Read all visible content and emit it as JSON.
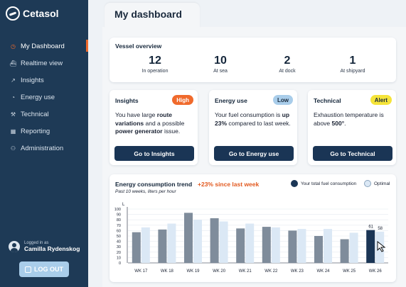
{
  "brand": {
    "name": "Cetasol"
  },
  "nav": [
    {
      "label": "My Dashboard",
      "icon": "dashboard-icon",
      "active": true
    },
    {
      "label": "Realtime view",
      "icon": "ship-icon",
      "active": false
    },
    {
      "label": "Insights",
      "icon": "trend-icon",
      "active": false
    },
    {
      "label": "Energy use",
      "icon": "gauge-icon",
      "active": false
    },
    {
      "label": "Technical",
      "icon": "wrench-icon",
      "active": false
    },
    {
      "label": "Reporting",
      "icon": "table-icon",
      "active": false
    },
    {
      "label": "Administration",
      "icon": "user-icon",
      "active": false
    }
  ],
  "user": {
    "label": "Logged in as",
    "name": "Camilla Rydenskog"
  },
  "logout_label": "LOG OUT",
  "page_title": "My dashboard",
  "vessel": {
    "title": "Vessel overview",
    "stats": [
      {
        "value": "12",
        "label": "In operation"
      },
      {
        "value": "10",
        "label": "At sea"
      },
      {
        "value": "2",
        "label": "At dock"
      },
      {
        "value": "1",
        "label": "At shipyard"
      }
    ]
  },
  "cards": {
    "insights": {
      "title": "Insights",
      "badge": "High",
      "badge_color": "#f06a2c",
      "badge_text_color": "#ffffff",
      "t1": "You have large ",
      "b1": "route variations",
      "t2": " and a possible ",
      "b2": "power generator",
      "t3": " issue.",
      "button": "Go to Insights"
    },
    "energy": {
      "title": "Energy use",
      "badge": "Low",
      "badge_color": "#a9cdea",
      "badge_text_color": "#1a2a3d",
      "t1": "Your fuel consumption is ",
      "b1": "up 23%",
      "t2": " compared to last week.",
      "button": "Go to Energy use"
    },
    "technical": {
      "title": "Technical",
      "badge": "Alert",
      "badge_color": "#f5e43a",
      "badge_text_color": "#1a2a3d",
      "t1": "Exhaustion temperature is above ",
      "b1": "500°",
      "t2": ".",
      "button": "Go to Technical"
    }
  },
  "chart_data": {
    "type": "bar",
    "title": "Energy consumption trend",
    "delta": "+23% since last week",
    "subtitle": "Past 10 weeks, liters per hour",
    "ylabel": "L",
    "ylim": [
      0,
      100
    ],
    "yticks": [
      0,
      10,
      20,
      30,
      40,
      50,
      60,
      70,
      80,
      90,
      100
    ],
    "categories": [
      "WK 17",
      "WK 18",
      "WK 19",
      "WK 20",
      "WK 21",
      "WK 22",
      "WK 23",
      "WK 24",
      "WK 25",
      "WK 26"
    ],
    "series": [
      {
        "name": "Your total fuel consumption",
        "color": "#7f8c9b",
        "highlight_color": "#1a3555",
        "values": [
          57,
          62,
          93,
          83,
          64,
          67,
          60,
          50,
          44,
          61
        ]
      },
      {
        "name": "Optimal",
        "color": "#dbe8f5",
        "values": [
          66,
          73,
          80,
          77,
          73,
          66,
          63,
          63,
          56,
          58
        ]
      }
    ],
    "labels": {
      "last_total": "61",
      "last_optimal": "58"
    }
  },
  "colors": {
    "sidebar": "#1e3a56",
    "accent": "#f06a2c",
    "button": "#1a3555"
  }
}
